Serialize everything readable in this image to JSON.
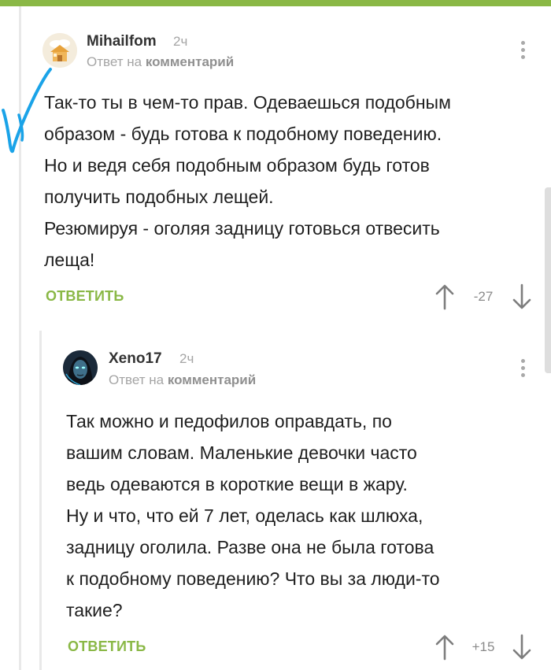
{
  "comments": [
    {
      "author": "Mihailfom",
      "time": "2ч",
      "reply_prefix": "Ответ на",
      "reply_target": "комментарий",
      "lines": [
        "Так-то ты в чем-то прав. Одеваешься подобным",
        "образом - будь готова к подобному поведению.",
        "Но и ведя себя подобным образом будь готов",
        "получить подобных лещей.",
        "Резюмируя - оголяя задницу готовься отвесить",
        "леща!"
      ],
      "reply_label": "ОТВЕТИТЬ",
      "rating": "-27",
      "avatar_icon": "house-avatar-icon"
    },
    {
      "author": "Xeno17",
      "time": "2ч",
      "reply_prefix": "Ответ на",
      "reply_target": "комментарий",
      "lines": [
        "Так можно и педофилов оправдать, по",
        "вашим словам. Маленькие девочки часто",
        "ведь одеваются в короткие вещи в жару.",
        "Ну и что, что ей 7 лет, оделась как шлюха,",
        "задницу оголила. Разве она не была готова",
        "к подобному поведению? Что вы за люди-то",
        "такие?"
      ],
      "reply_label": "ОТВЕТИТЬ",
      "rating": "+15",
      "avatar_icon": "character-avatar-icon"
    }
  ],
  "colors": {
    "accent": "#8ab846",
    "meta": "#a5a5a5",
    "annotation": "#1aa3e8"
  }
}
